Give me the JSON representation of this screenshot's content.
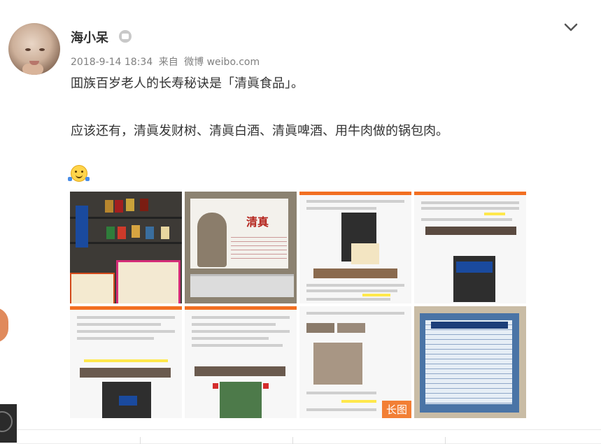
{
  "post": {
    "author": "海小呆",
    "timestamp": "2018-9-14 18:34",
    "source_prefix": "来自",
    "source": "微博 weibo.com",
    "text_line1": "囬族百岁老人的长寿秘诀是「清眞食品」。",
    "text_line2": "应该还有，清眞发财树、清眞白酒、清眞啤酒、用牛肉做的锅包肉。",
    "emoji_name": "hug-emoji",
    "long_image_badge": "长图"
  },
  "icons": {
    "verified": "vip-badge-icon",
    "menu": "chevron-down-icon"
  },
  "colors": {
    "author": "#333333",
    "meta": "#808080",
    "badge": "#f27f35"
  }
}
